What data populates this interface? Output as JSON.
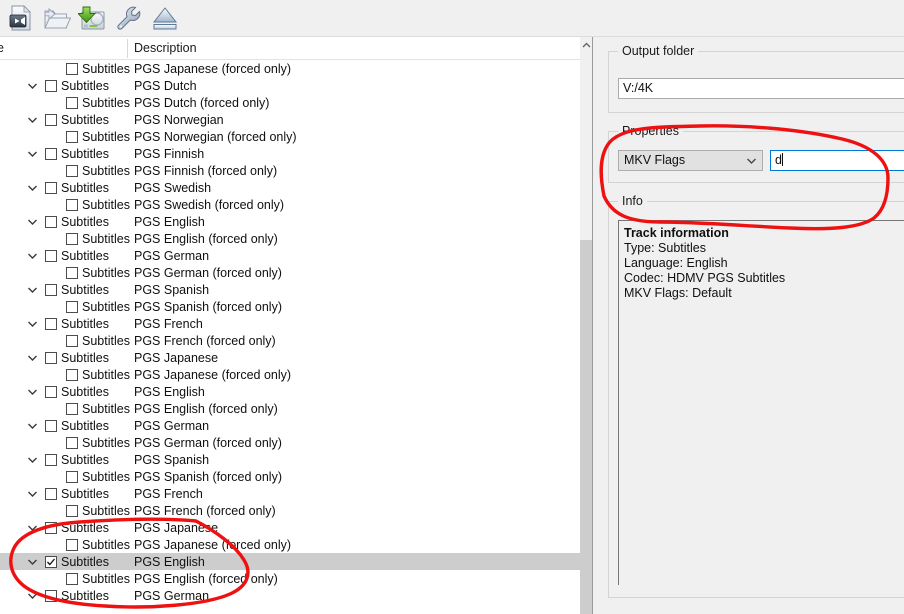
{
  "toolbar": {
    "buttons": [
      {
        "name": "open-disc-button",
        "icon": "video-file-icon",
        "label": "Open disc"
      },
      {
        "name": "open-files-button",
        "icon": "open-folder-icon",
        "label": "Open files"
      },
      {
        "name": "backup-button",
        "icon": "drive-download-icon",
        "label": "Backup"
      },
      {
        "name": "settings-button",
        "icon": "wrench-icon",
        "label": "Settings"
      },
      {
        "name": "eject-button",
        "icon": "eject-icon",
        "label": "Eject"
      }
    ]
  },
  "tree": {
    "columns": [
      "pe",
      "Description"
    ],
    "rows": [
      {
        "level": 1,
        "checked": false,
        "type": "Subtitles",
        "desc": "PGS Japanese",
        "forced": "(forced only)",
        "selected": false
      },
      {
        "level": 0,
        "checked": false,
        "type": "Subtitles",
        "desc": "PGS Dutch",
        "forced": "",
        "selected": false
      },
      {
        "level": 1,
        "checked": false,
        "type": "Subtitles",
        "desc": "PGS Dutch",
        "forced": "(forced only)",
        "selected": false
      },
      {
        "level": 0,
        "checked": false,
        "type": "Subtitles",
        "desc": "PGS Norwegian",
        "forced": "",
        "selected": false
      },
      {
        "level": 1,
        "checked": false,
        "type": "Subtitles",
        "desc": "PGS Norwegian",
        "forced": "(forced only)",
        "selected": false
      },
      {
        "level": 0,
        "checked": false,
        "type": "Subtitles",
        "desc": "PGS Finnish",
        "forced": "",
        "selected": false
      },
      {
        "level": 1,
        "checked": false,
        "type": "Subtitles",
        "desc": "PGS Finnish",
        "forced": "(forced only)",
        "selected": false
      },
      {
        "level": 0,
        "checked": false,
        "type": "Subtitles",
        "desc": "PGS Swedish",
        "forced": "",
        "selected": false
      },
      {
        "level": 1,
        "checked": false,
        "type": "Subtitles",
        "desc": "PGS Swedish",
        "forced": "(forced only)",
        "selected": false
      },
      {
        "level": 0,
        "checked": false,
        "type": "Subtitles",
        "desc": "PGS English",
        "forced": "",
        "selected": false
      },
      {
        "level": 1,
        "checked": false,
        "type": "Subtitles",
        "desc": "PGS English",
        "forced": "(forced only)",
        "selected": false
      },
      {
        "level": 0,
        "checked": false,
        "type": "Subtitles",
        "desc": "PGS German",
        "forced": "",
        "selected": false
      },
      {
        "level": 1,
        "checked": false,
        "type": "Subtitles",
        "desc": "PGS German",
        "forced": "(forced only)",
        "selected": false
      },
      {
        "level": 0,
        "checked": false,
        "type": "Subtitles",
        "desc": "PGS Spanish",
        "forced": "",
        "selected": false
      },
      {
        "level": 1,
        "checked": false,
        "type": "Subtitles",
        "desc": "PGS Spanish",
        "forced": "(forced only)",
        "selected": false
      },
      {
        "level": 0,
        "checked": false,
        "type": "Subtitles",
        "desc": "PGS French",
        "forced": "",
        "selected": false
      },
      {
        "level": 1,
        "checked": false,
        "type": "Subtitles",
        "desc": "PGS French",
        "forced": "(forced only)",
        "selected": false
      },
      {
        "level": 0,
        "checked": false,
        "type": "Subtitles",
        "desc": "PGS Japanese",
        "forced": "",
        "selected": false
      },
      {
        "level": 1,
        "checked": false,
        "type": "Subtitles",
        "desc": "PGS Japanese",
        "forced": "(forced only)",
        "selected": false
      },
      {
        "level": 0,
        "checked": false,
        "type": "Subtitles",
        "desc": "PGS English",
        "forced": "",
        "selected": false
      },
      {
        "level": 1,
        "checked": false,
        "type": "Subtitles",
        "desc": "PGS English",
        "forced": "(forced only)",
        "selected": false
      },
      {
        "level": 0,
        "checked": false,
        "type": "Subtitles",
        "desc": "PGS German",
        "forced": "",
        "selected": false
      },
      {
        "level": 1,
        "checked": false,
        "type": "Subtitles",
        "desc": "PGS German",
        "forced": "(forced only)",
        "selected": false
      },
      {
        "level": 0,
        "checked": false,
        "type": "Subtitles",
        "desc": "PGS Spanish",
        "forced": "",
        "selected": false
      },
      {
        "level": 1,
        "checked": false,
        "type": "Subtitles",
        "desc": "PGS Spanish",
        "forced": "(forced only)",
        "selected": false
      },
      {
        "level": 0,
        "checked": false,
        "type": "Subtitles",
        "desc": "PGS French",
        "forced": "",
        "selected": false
      },
      {
        "level": 1,
        "checked": false,
        "type": "Subtitles",
        "desc": "PGS French",
        "forced": "(forced only)",
        "selected": false
      },
      {
        "level": 0,
        "checked": false,
        "type": "Subtitles",
        "desc": "PGS Japanese",
        "forced": "",
        "selected": false
      },
      {
        "level": 1,
        "checked": false,
        "type": "Subtitles",
        "desc": "PGS Japanese",
        "forced": "(forced only)",
        "selected": false
      },
      {
        "level": 0,
        "checked": true,
        "type": "Subtitles",
        "desc": "PGS English",
        "forced": "",
        "selected": true
      },
      {
        "level": 1,
        "checked": false,
        "type": "Subtitles",
        "desc": "PGS English",
        "forced": "(forced only)",
        "selected": false
      },
      {
        "level": 0,
        "checked": false,
        "type": "Subtitles",
        "desc": "PGS German",
        "forced": "",
        "selected": false
      }
    ]
  },
  "right": {
    "output_folder": {
      "title": "Output folder",
      "value": "V:/4K"
    },
    "properties": {
      "title": "Properties",
      "select_value": "MKV Flags",
      "field_value": "d"
    },
    "info": {
      "title": "Info",
      "heading": "Track information",
      "lines": [
        "Type: Subtitles",
        "Language: English",
        "Codec: HDMV PGS Subtitles",
        "MKV Flags: Default"
      ]
    }
  },
  "annotation": {
    "color": "#ee1111",
    "shapes": [
      "properties-info-ellipse",
      "selected-row-ellipse"
    ]
  }
}
